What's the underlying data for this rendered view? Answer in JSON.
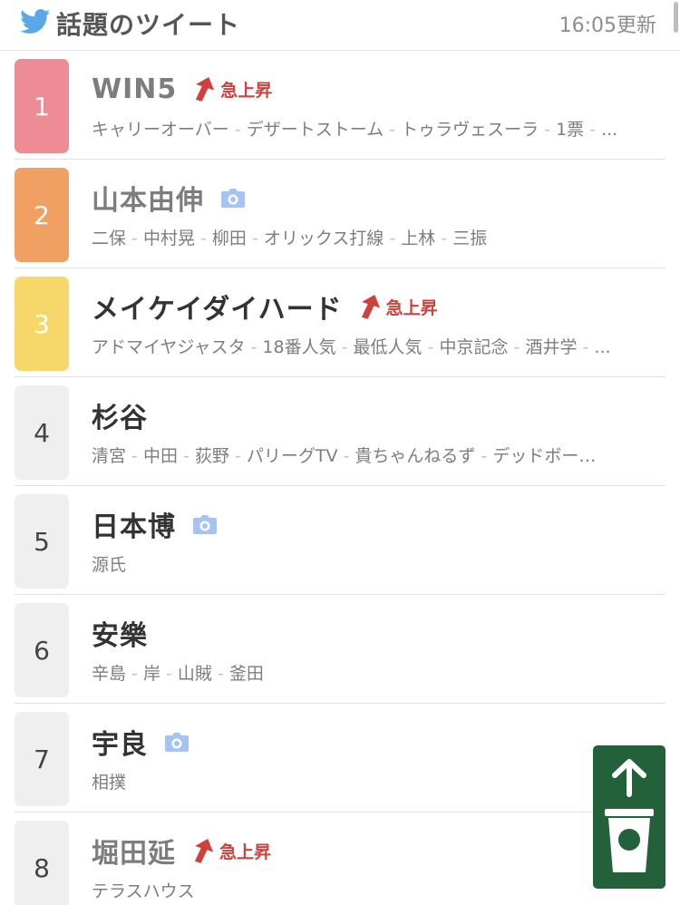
{
  "header": {
    "title": "話題のツイート",
    "updated": "16:05更新",
    "logo_icon": "twitter-bird-icon"
  },
  "badge_label": "急上昇",
  "colors": {
    "rank1": "#ed8c94",
    "rank2": "#f0a063",
    "rank3": "#f6d86a",
    "rank_other": "#efefef",
    "rise": "#d0403d",
    "camera": "#a5c3f6",
    "fab": "#23613b",
    "twitter_blue": "#5aa8e8"
  },
  "trends": [
    {
      "rank": "1",
      "title": "WIN5",
      "rising": true,
      "camera": false,
      "dim": true,
      "tags": [
        "キャリーオーバー",
        "デザートストーム",
        "トゥラヴェスーラ",
        "1票",
        "..."
      ]
    },
    {
      "rank": "2",
      "title": "山本由伸",
      "rising": false,
      "camera": true,
      "dim": true,
      "tags": [
        "二保",
        "中村晃",
        "柳田",
        "オリックス打線",
        "上林",
        "三振"
      ]
    },
    {
      "rank": "3",
      "title": "メイケイダイハード",
      "rising": true,
      "camera": false,
      "dim": false,
      "tags": [
        "アドマイヤジャスタ",
        "18番人気",
        "最低人気",
        "中京記念",
        "酒井学",
        "..."
      ]
    },
    {
      "rank": "4",
      "title": "杉谷",
      "rising": false,
      "camera": false,
      "dim": false,
      "tags": [
        "清宮",
        "中田",
        "荻野",
        "パリーグTV",
        "貴ちゃんねるず",
        "デッドボー…"
      ]
    },
    {
      "rank": "5",
      "title": "日本博",
      "rising": false,
      "camera": true,
      "dim": false,
      "tags": [
        "源氏"
      ]
    },
    {
      "rank": "6",
      "title": "安樂",
      "rising": false,
      "camera": false,
      "dim": false,
      "tags": [
        "辛島",
        "岸",
        "山賊",
        "釜田"
      ]
    },
    {
      "rank": "7",
      "title": "宇良",
      "rising": false,
      "camera": true,
      "dim": false,
      "tags": [
        "相撲"
      ]
    },
    {
      "rank": "8",
      "title": "堀田延",
      "rising": true,
      "camera": false,
      "dim": true,
      "tags": [
        "テラスハウス"
      ]
    }
  ],
  "fab": {
    "icon": "scroll-to-top-cup-icon"
  }
}
